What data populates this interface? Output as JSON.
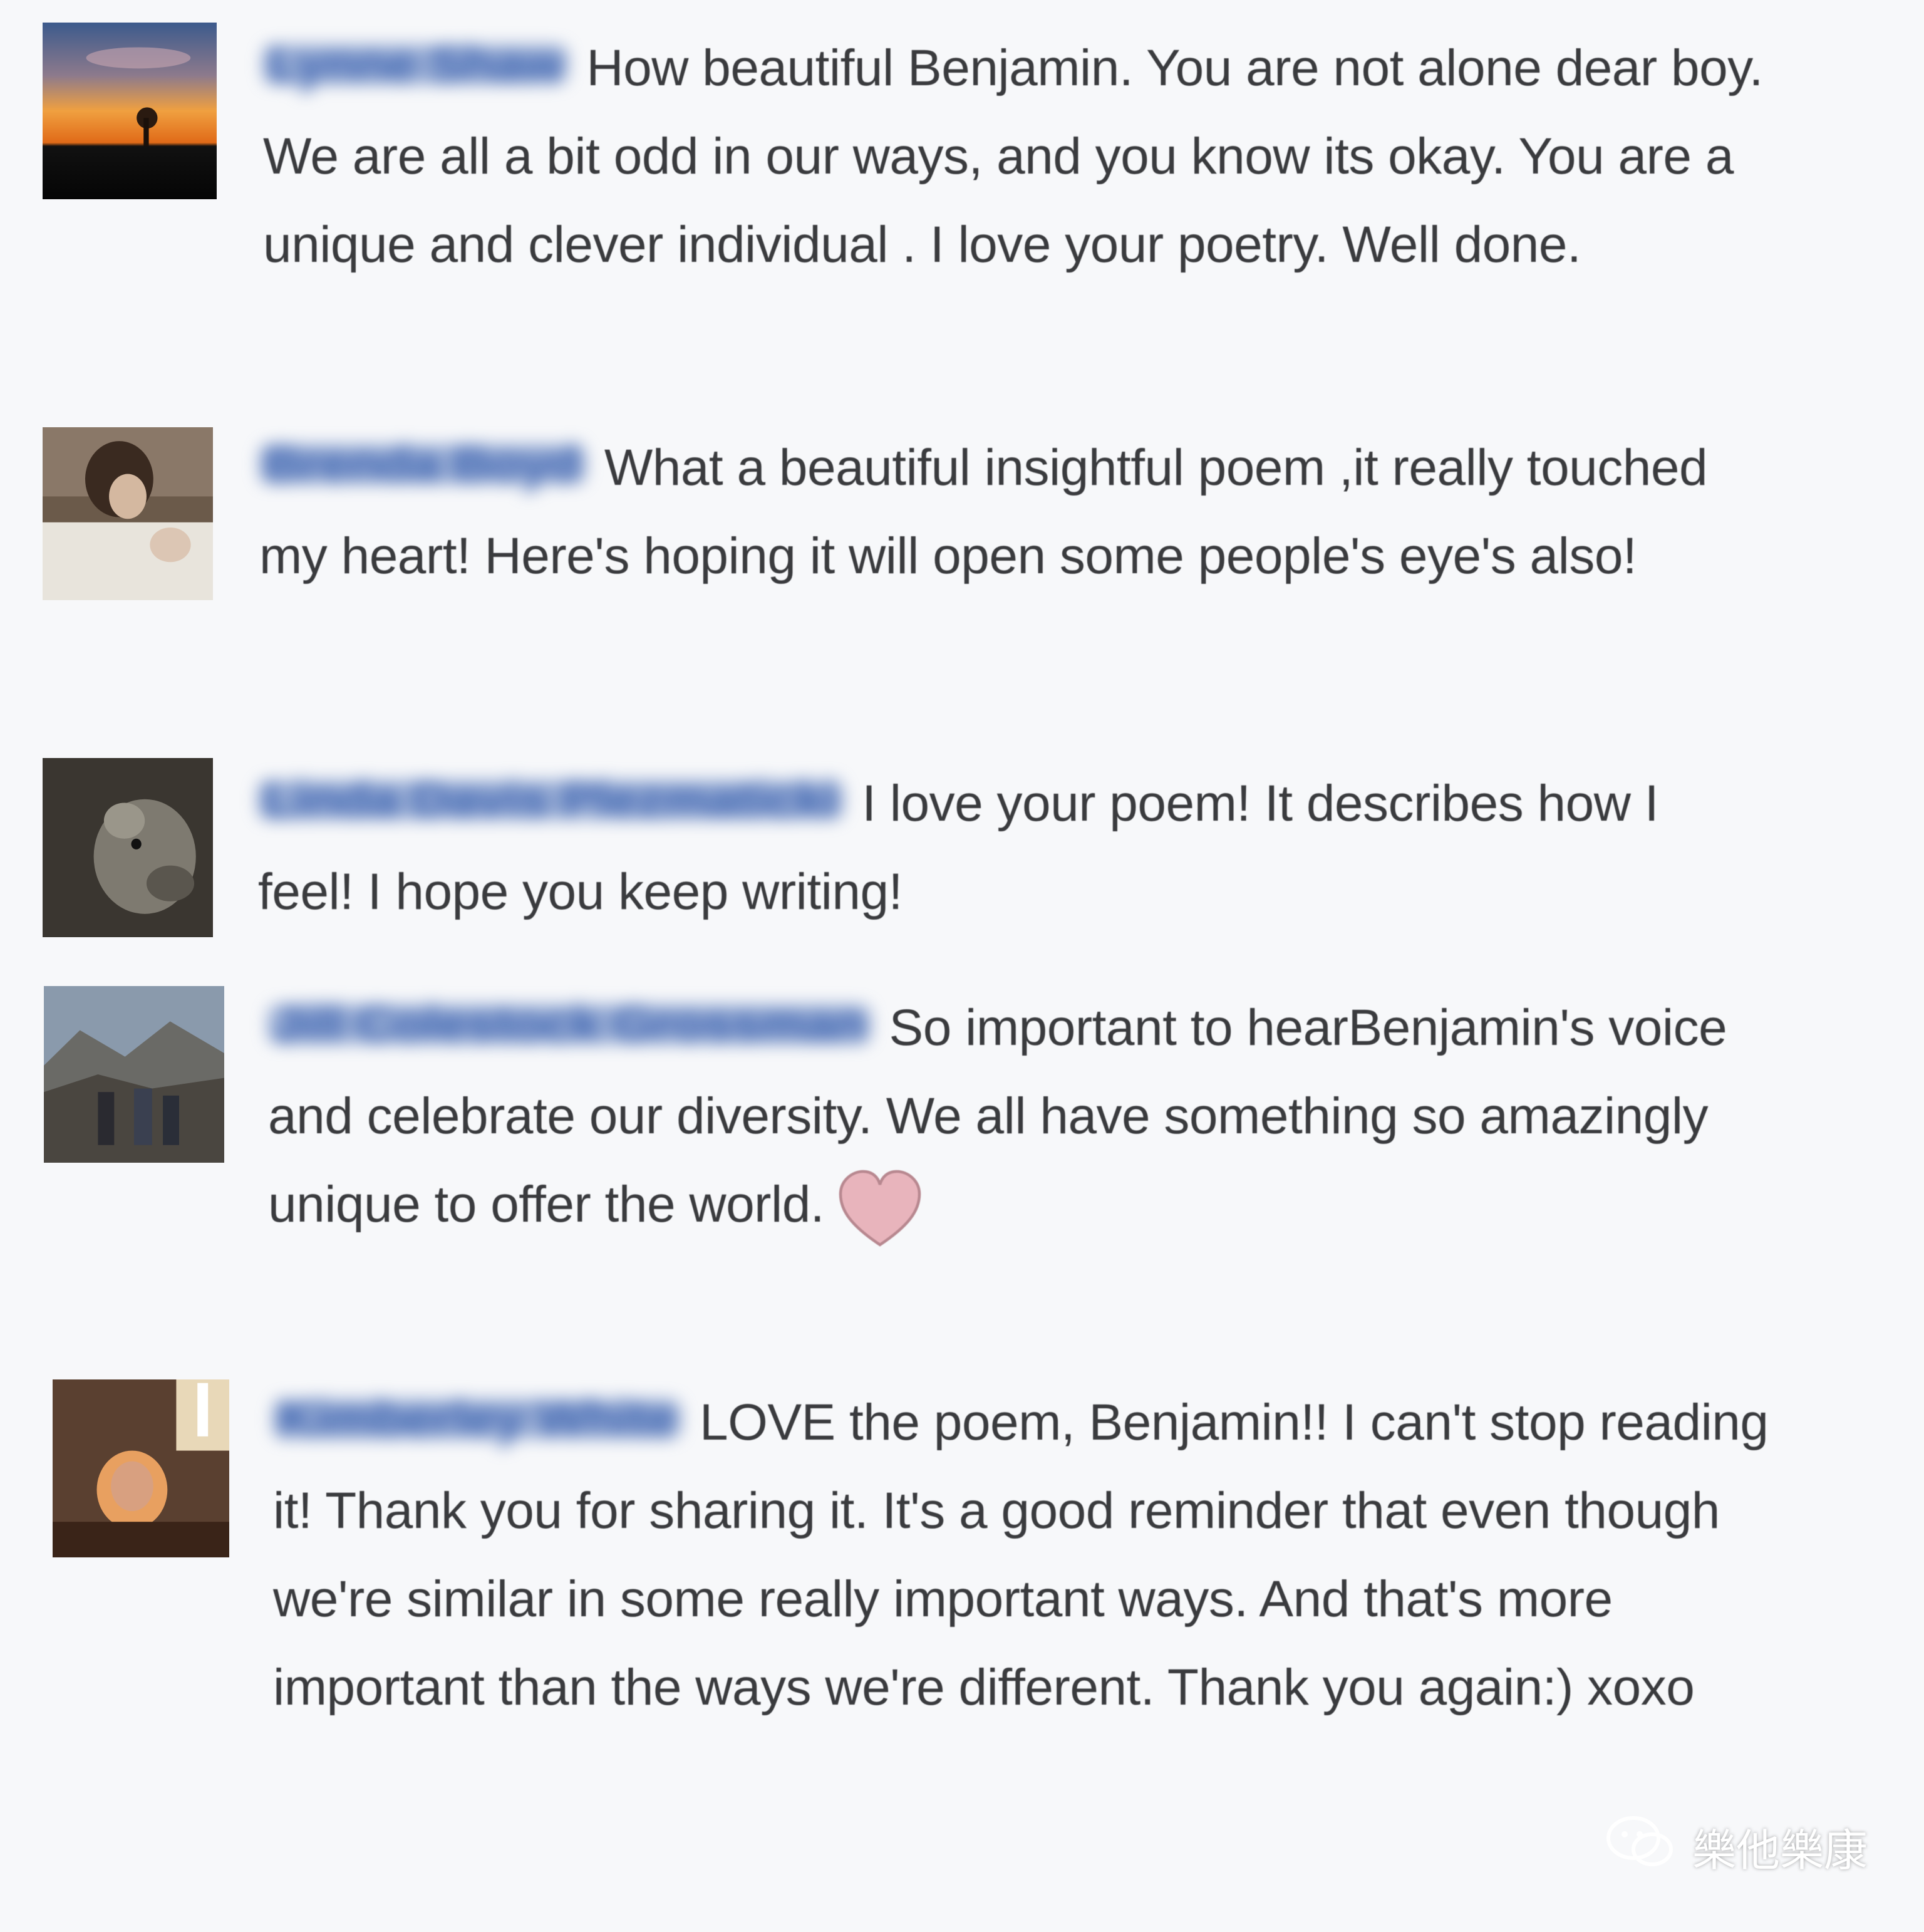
{
  "comments": [
    {
      "author": "Lynne Shaw",
      "text": "How beautiful Benjamin. You are not alone dear boy. We are all a bit odd in our ways, and you know its okay. You are a unique and clever individual . I love your poetry. Well done.",
      "avatar_icon": "sunset-landscape-avatar"
    },
    {
      "author": "Brenda Boyd",
      "text": "What a beautiful insightful poem ,it really touched my heart! Here's hoping it will open some people's eye's also!",
      "avatar_icon": "person-with-baby-avatar"
    },
    {
      "author": "Linda Davis Plezmaticki",
      "text": "I love your poem! It describes how I feel! I hope you keep writing!",
      "avatar_icon": "dog-photo-avatar"
    },
    {
      "author": "Jill Colestock Grossman",
      "text": "So important to hearBenjamin's voice and celebrate our diversity. We all have something so amazingly unique to offer the world.",
      "avatar_icon": "mountain-group-avatar",
      "emoji": "heart-icon"
    },
    {
      "author": "Kimberley White",
      "text": "LOVE the poem, Benjamin!! I can't stop reading it! Thank you for sharing it. It's a good reminder that even though we're similar in some really important ways. And that's more important than the ways we're different. Thank you again:) xoxo",
      "avatar_icon": "indoor-portrait-avatar"
    }
  ],
  "watermark": {
    "label": "樂他樂康",
    "icon": "wechat-icon"
  },
  "colors": {
    "background": "#f7f8fa",
    "author_link": "#4267b2",
    "body_text": "#3a3b3e",
    "heart": "#e8b4bc"
  }
}
